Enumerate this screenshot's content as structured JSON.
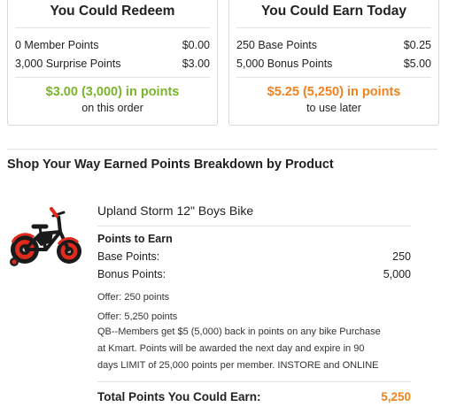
{
  "redeem": {
    "title": "You Could Redeem",
    "rows": [
      {
        "label": "0 Member Points",
        "value": "$0.00"
      },
      {
        "label": "3,000 Surprise Points",
        "value": "$3.00"
      }
    ],
    "total": "$3.00 (3,000) in points",
    "subtext": "on this order",
    "total_color": "#7ab42a"
  },
  "earn": {
    "title": "You Could Earn Today",
    "rows": [
      {
        "label": "250 Base Points",
        "value": "$0.25"
      },
      {
        "label": "5,000 Bonus Points",
        "value": "$5.00"
      }
    ],
    "total": "$5.25 (5,250)  in points",
    "subtext": "to use later",
    "total_color": "#f0821e"
  },
  "breakdown": {
    "title": "Shop Your Way Earned Points Breakdown by Product"
  },
  "product": {
    "image_icon": "bike-icon",
    "name": "Upland Storm 12\" Boys Bike",
    "points_heading": "Points to Earn",
    "base_label": "Base Points:",
    "base_value": "250",
    "bonus_label": "Bonus Points:",
    "bonus_value": "5,000",
    "offer1": "Offer: 250 points",
    "offer2": "Offer: 5,250 points",
    "promo_lines": [
      "QB--Members get $5 (5,000) back in points on any bike Purchase",
      "at Kmart. Points will be awarded the next day and expire in 90",
      "days LIMIT of 25,000 points per member. INSTORE and ONLINE"
    ],
    "total_label": "Total Points You Could Earn:",
    "total_value": "5,250"
  }
}
